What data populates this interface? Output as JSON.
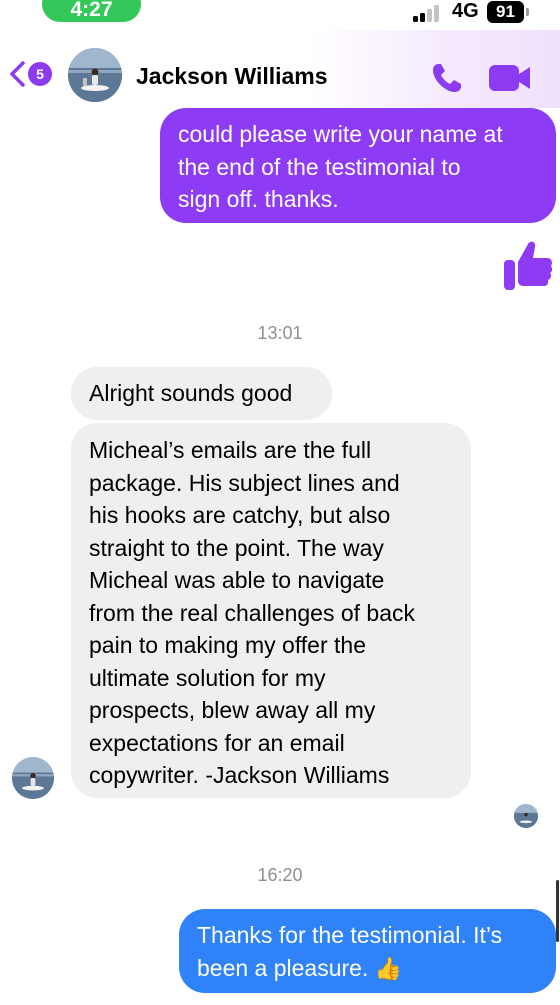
{
  "status_bar": {
    "time": "4:27",
    "network": "4G",
    "battery": "91"
  },
  "header": {
    "unread_count": "5",
    "contact_name": "Jackson Williams",
    "accent_color": "#8c3bf0"
  },
  "messages": {
    "outgoing_1": {
      "lines": [
        "could please write your name at",
        "the end of the testimonial to",
        "sign off. thanks."
      ]
    },
    "reaction": "thumbs-up-icon",
    "timestamp_1": "13:01",
    "incoming_1": "Alright sounds good",
    "incoming_2": {
      "lines": [
        "Micheal’s emails are the full",
        "package. His subject lines and",
        "his hooks are catchy, but also",
        "straight to the point. The way",
        "Micheal was able to navigate",
        "from the real challenges of back",
        "pain to making my offer the",
        "ultimate solution for my",
        "prospects, blew away all my",
        "expectations for an email",
        "copywriter. -Jackson Williams"
      ]
    },
    "timestamp_2": "16:20",
    "outgoing_2": {
      "lines": [
        "Thanks for the testimonial. It’s",
        "been a pleasure."
      ],
      "emoji": "👍"
    }
  },
  "colors": {
    "outgoing_bubble": "#8d3bf4",
    "incoming_bubble": "#efefef",
    "sent_bubble_blue": "#2f82f7"
  }
}
